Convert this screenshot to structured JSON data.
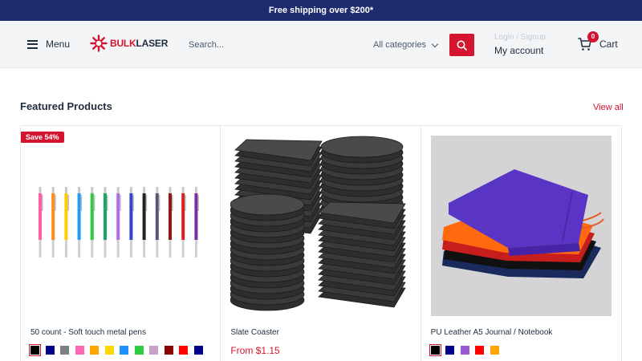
{
  "announcement": "Free shipping over $200*",
  "header": {
    "menu_label": "Menu",
    "logo": {
      "part1": "BULK",
      "part2": "LASER"
    },
    "search": {
      "placeholder": "Search...",
      "category": "All categories"
    },
    "account": {
      "login": "Login / Signup",
      "my_account": "My account"
    },
    "cart": {
      "label": "Cart",
      "count": "0"
    }
  },
  "featured": {
    "title": "Featured Products",
    "view_all": "View all",
    "products": [
      {
        "title": "50 count - Soft touch metal pens",
        "badge": "Save 54%",
        "swatches": [
          "#000000",
          "#00008b",
          "#808080",
          "#ff69b4",
          "#ffa500",
          "#ffd700",
          "#1e90ff",
          "#2ecc40",
          "#c8a2c8",
          "#8b0000",
          "#ff0000",
          "#00008b"
        ]
      },
      {
        "title": "Slate Coaster",
        "price": "From $1.15"
      },
      {
        "title": "PU Leather A5 Journal / Notebook",
        "swatches": [
          "#000000",
          "#00008b",
          "#9b59d0",
          "#ff0000",
          "#ffa500"
        ]
      }
    ]
  },
  "colors": {
    "accent": "#d3152f",
    "topbar": "#1e2b6f",
    "text": "#1e2d3d"
  }
}
